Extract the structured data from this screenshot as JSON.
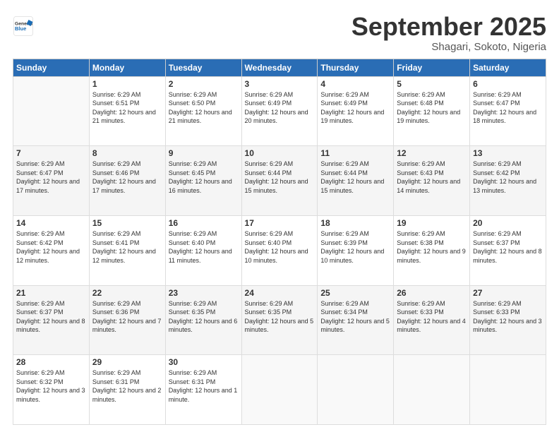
{
  "logo": {
    "general": "General",
    "blue": "Blue"
  },
  "header": {
    "month": "September 2025",
    "location": "Shagari, Sokoto, Nigeria"
  },
  "days_of_week": [
    "Sunday",
    "Monday",
    "Tuesday",
    "Wednesday",
    "Thursday",
    "Friday",
    "Saturday"
  ],
  "weeks": [
    [
      {
        "day": "",
        "sunrise": "",
        "sunset": "",
        "daylight": ""
      },
      {
        "day": "1",
        "sunrise": "Sunrise: 6:29 AM",
        "sunset": "Sunset: 6:51 PM",
        "daylight": "Daylight: 12 hours and 21 minutes."
      },
      {
        "day": "2",
        "sunrise": "Sunrise: 6:29 AM",
        "sunset": "Sunset: 6:50 PM",
        "daylight": "Daylight: 12 hours and 21 minutes."
      },
      {
        "day": "3",
        "sunrise": "Sunrise: 6:29 AM",
        "sunset": "Sunset: 6:49 PM",
        "daylight": "Daylight: 12 hours and 20 minutes."
      },
      {
        "day": "4",
        "sunrise": "Sunrise: 6:29 AM",
        "sunset": "Sunset: 6:49 PM",
        "daylight": "Daylight: 12 hours and 19 minutes."
      },
      {
        "day": "5",
        "sunrise": "Sunrise: 6:29 AM",
        "sunset": "Sunset: 6:48 PM",
        "daylight": "Daylight: 12 hours and 19 minutes."
      },
      {
        "day": "6",
        "sunrise": "Sunrise: 6:29 AM",
        "sunset": "Sunset: 6:47 PM",
        "daylight": "Daylight: 12 hours and 18 minutes."
      }
    ],
    [
      {
        "day": "7",
        "sunrise": "Sunrise: 6:29 AM",
        "sunset": "Sunset: 6:47 PM",
        "daylight": "Daylight: 12 hours and 17 minutes."
      },
      {
        "day": "8",
        "sunrise": "Sunrise: 6:29 AM",
        "sunset": "Sunset: 6:46 PM",
        "daylight": "Daylight: 12 hours and 17 minutes."
      },
      {
        "day": "9",
        "sunrise": "Sunrise: 6:29 AM",
        "sunset": "Sunset: 6:45 PM",
        "daylight": "Daylight: 12 hours and 16 minutes."
      },
      {
        "day": "10",
        "sunrise": "Sunrise: 6:29 AM",
        "sunset": "Sunset: 6:44 PM",
        "daylight": "Daylight: 12 hours and 15 minutes."
      },
      {
        "day": "11",
        "sunrise": "Sunrise: 6:29 AM",
        "sunset": "Sunset: 6:44 PM",
        "daylight": "Daylight: 12 hours and 15 minutes."
      },
      {
        "day": "12",
        "sunrise": "Sunrise: 6:29 AM",
        "sunset": "Sunset: 6:43 PM",
        "daylight": "Daylight: 12 hours and 14 minutes."
      },
      {
        "day": "13",
        "sunrise": "Sunrise: 6:29 AM",
        "sunset": "Sunset: 6:42 PM",
        "daylight": "Daylight: 12 hours and 13 minutes."
      }
    ],
    [
      {
        "day": "14",
        "sunrise": "Sunrise: 6:29 AM",
        "sunset": "Sunset: 6:42 PM",
        "daylight": "Daylight: 12 hours and 12 minutes."
      },
      {
        "day": "15",
        "sunrise": "Sunrise: 6:29 AM",
        "sunset": "Sunset: 6:41 PM",
        "daylight": "Daylight: 12 hours and 12 minutes."
      },
      {
        "day": "16",
        "sunrise": "Sunrise: 6:29 AM",
        "sunset": "Sunset: 6:40 PM",
        "daylight": "Daylight: 12 hours and 11 minutes."
      },
      {
        "day": "17",
        "sunrise": "Sunrise: 6:29 AM",
        "sunset": "Sunset: 6:40 PM",
        "daylight": "Daylight: 12 hours and 10 minutes."
      },
      {
        "day": "18",
        "sunrise": "Sunrise: 6:29 AM",
        "sunset": "Sunset: 6:39 PM",
        "daylight": "Daylight: 12 hours and 10 minutes."
      },
      {
        "day": "19",
        "sunrise": "Sunrise: 6:29 AM",
        "sunset": "Sunset: 6:38 PM",
        "daylight": "Daylight: 12 hours and 9 minutes."
      },
      {
        "day": "20",
        "sunrise": "Sunrise: 6:29 AM",
        "sunset": "Sunset: 6:37 PM",
        "daylight": "Daylight: 12 hours and 8 minutes."
      }
    ],
    [
      {
        "day": "21",
        "sunrise": "Sunrise: 6:29 AM",
        "sunset": "Sunset: 6:37 PM",
        "daylight": "Daylight: 12 hours and 8 minutes."
      },
      {
        "day": "22",
        "sunrise": "Sunrise: 6:29 AM",
        "sunset": "Sunset: 6:36 PM",
        "daylight": "Daylight: 12 hours and 7 minutes."
      },
      {
        "day": "23",
        "sunrise": "Sunrise: 6:29 AM",
        "sunset": "Sunset: 6:35 PM",
        "daylight": "Daylight: 12 hours and 6 minutes."
      },
      {
        "day": "24",
        "sunrise": "Sunrise: 6:29 AM",
        "sunset": "Sunset: 6:35 PM",
        "daylight": "Daylight: 12 hours and 5 minutes."
      },
      {
        "day": "25",
        "sunrise": "Sunrise: 6:29 AM",
        "sunset": "Sunset: 6:34 PM",
        "daylight": "Daylight: 12 hours and 5 minutes."
      },
      {
        "day": "26",
        "sunrise": "Sunrise: 6:29 AM",
        "sunset": "Sunset: 6:33 PM",
        "daylight": "Daylight: 12 hours and 4 minutes."
      },
      {
        "day": "27",
        "sunrise": "Sunrise: 6:29 AM",
        "sunset": "Sunset: 6:33 PM",
        "daylight": "Daylight: 12 hours and 3 minutes."
      }
    ],
    [
      {
        "day": "28",
        "sunrise": "Sunrise: 6:29 AM",
        "sunset": "Sunset: 6:32 PM",
        "daylight": "Daylight: 12 hours and 3 minutes."
      },
      {
        "day": "29",
        "sunrise": "Sunrise: 6:29 AM",
        "sunset": "Sunset: 6:31 PM",
        "daylight": "Daylight: 12 hours and 2 minutes."
      },
      {
        "day": "30",
        "sunrise": "Sunrise: 6:29 AM",
        "sunset": "Sunset: 6:31 PM",
        "daylight": "Daylight: 12 hours and 1 minute."
      },
      {
        "day": "",
        "sunrise": "",
        "sunset": "",
        "daylight": ""
      },
      {
        "day": "",
        "sunrise": "",
        "sunset": "",
        "daylight": ""
      },
      {
        "day": "",
        "sunrise": "",
        "sunset": "",
        "daylight": ""
      },
      {
        "day": "",
        "sunrise": "",
        "sunset": "",
        "daylight": ""
      }
    ]
  ]
}
